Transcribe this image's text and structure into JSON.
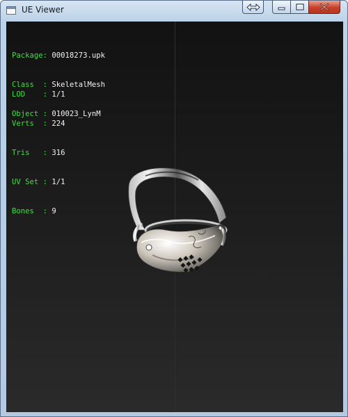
{
  "window": {
    "title": "UE Viewer",
    "icon": "app-window-icon",
    "buttons": {
      "restore": "double-arrow-icon",
      "minimize": "minimize-icon",
      "maximize": "maximize-icon",
      "close": "close-icon"
    }
  },
  "info": {
    "package": {
      "key": "Package:",
      "value": "00018273.upk"
    },
    "class": {
      "key": "Class  :",
      "value": "SkeletalMesh"
    },
    "object": {
      "key": "Object :",
      "value": "010023_LynM"
    },
    "lod": {
      "key": "LOD    :",
      "value": "1/1"
    },
    "verts": {
      "key": "Verts  :",
      "value": "224"
    },
    "tris": {
      "key": "Tris   :",
      "value": "316"
    },
    "uvset": {
      "key": "UV Set :",
      "value": "1/1"
    },
    "bones": {
      "key": "Bones  :",
      "value": "9"
    }
  },
  "colors": {
    "label": "#3ee03e",
    "value": "#f2f2f2",
    "axis": "#1d1db8",
    "background_top": "#121212",
    "background_bottom": "#2a2a2a"
  }
}
